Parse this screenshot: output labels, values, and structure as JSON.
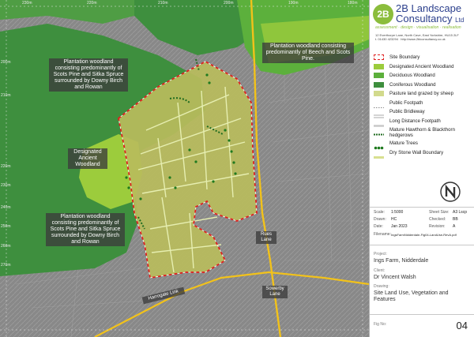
{
  "map": {
    "grid_top": [
      "230m",
      "220m",
      "210m",
      "200m",
      "190m",
      "180m"
    ],
    "grid_left": [
      "200m",
      "210m",
      "220m",
      "230m",
      "240m",
      "250m",
      "260m",
      "270m"
    ],
    "notes": {
      "plantation_nw": "Plantation woodland consisting predominantly of Scots Pine and Sitka Spruce surrounded by Downy Birch and Rowan",
      "plantation_ne": "Plantation woodland consisting predominantly of Beech and Scots Pine.",
      "ancient": "Designated Ancient Woodland",
      "plantation_sw": "Plantation woodland consisting predominantly of Scots Pine and Sitka Spruce surrounded by Downy Birch and Rowan"
    },
    "roads": {
      "rues_lane": "Rues Lane",
      "sowerby_lane": "Sowerby Lane",
      "harrogate_link": "Harrogate Link"
    },
    "colors": {
      "site_boundary": "#e02020",
      "ancient": "#9ccc3c",
      "deciduous": "#5cb03c",
      "coniferous": "#3e8f3e",
      "pasture": "#c8c878",
      "road": "#f2c21a"
    }
  },
  "panel": {
    "logo_mark": "2B",
    "company": "2B Landscape",
    "company_line2": "Consultancy",
    "company_suffix": "Ltd",
    "tagline": "assessment · design · visualisation · realisation",
    "address_line1": "12 Everthorpe Lane, North Cave, East Yorkshire, HU15 2LF",
    "address_line2": "t. 01430 423294",
    "address_url": "http://www.2blconsultancy.co.uk",
    "legend": [
      {
        "label": "Site Boundary",
        "symbol": "boundary"
      },
      {
        "label": "Designated Ancient Woodland",
        "symbol": "fill",
        "color": "#9ccc3c"
      },
      {
        "label": "Deciduous Woodland",
        "symbol": "fill",
        "color": "#5cb03c"
      },
      {
        "label": "Coniferous Woodland",
        "symbol": "fill",
        "color": "#3e8f3e"
      },
      {
        "label": "Pasture land grazed by sheep",
        "symbol": "fill",
        "color": "#d2da8c"
      },
      {
        "label": "Public Footpath",
        "symbol": "footpath"
      },
      {
        "label": "Public Bridleway",
        "symbol": "bridleway"
      },
      {
        "label": "Long Distance Footpath",
        "symbol": "ldfootpath"
      },
      {
        "label": "Mature Hawthorn & Blackthorn hedgerows",
        "symbol": "hedgerow"
      },
      {
        "label": "Mature Trees",
        "symbol": "trees"
      },
      {
        "label": "Dry Stone Wall Boundary",
        "symbol": "wall"
      }
    ],
    "info": {
      "scale_label": "Scale:",
      "scale_value": "1:5000",
      "sheet_label": "Sheet Size:",
      "sheet_value": "A3 Lscp",
      "drawn_label": "Drawn:",
      "drawn_value": "HC",
      "checked_label": "Checked:",
      "checked_value": "BB",
      "date_label": "Date:",
      "date_value": "Jan 2023",
      "revision_label": "Revision:",
      "revision_value": "A",
      "filename_label": "Filename:",
      "filename_value": "IngsFarmNidderdale-Fig04-LandUse-RevA.pdf"
    },
    "project_label": "Project:",
    "project_value": "Ings Farm, Nidderdale",
    "client_label": "Client:",
    "client_value": "Dr Vincent Walsh",
    "drawing_label": "Drawing:",
    "drawing_value": "Site Land Use, Vegetation and Features",
    "fig_label": "Fig No:",
    "fig_value": "04"
  }
}
